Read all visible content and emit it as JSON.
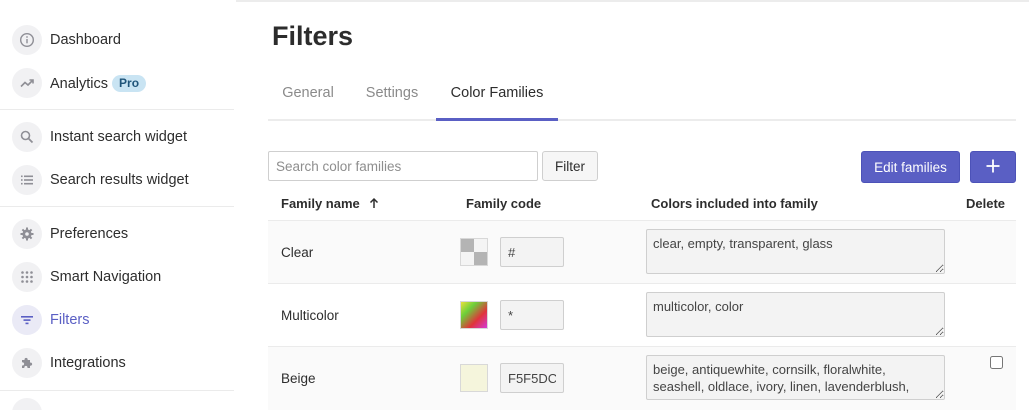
{
  "sidebar": {
    "items": [
      {
        "label": "Dashboard",
        "icon": "info-icon"
      },
      {
        "label": "Analytics",
        "badge": "Pro",
        "icon": "trending-up-icon"
      },
      {
        "label": "Instant search widget",
        "icon": "search-icon"
      },
      {
        "label": "Search results widget",
        "icon": "list-icon"
      },
      {
        "label": "Preferences",
        "icon": "gear-icon"
      },
      {
        "label": "Smart Navigation",
        "icon": "grid-icon"
      },
      {
        "label": "Filters",
        "icon": "filter-icon",
        "active": true
      },
      {
        "label": "Integrations",
        "icon": "puzzle-icon"
      }
    ]
  },
  "page": {
    "title": "Filters"
  },
  "tabs": [
    {
      "label": "General"
    },
    {
      "label": "Settings"
    },
    {
      "label": "Color Families",
      "active": true
    }
  ],
  "toolbar": {
    "search_placeholder": "Search color families",
    "filter_label": "Filter",
    "edit_label": "Edit families",
    "add_icon": "plus-icon"
  },
  "table": {
    "headers": {
      "name": "Family name",
      "name_sort_icon": "arrow-up-icon",
      "code": "Family code",
      "colors": "Colors included into family",
      "delete": "Delete"
    },
    "rows": [
      {
        "name": "Clear",
        "code": "#",
        "colors": "clear, empty, transparent, glass",
        "swatch": "transparent-checker",
        "delete_visible": false
      },
      {
        "name": "Multicolor",
        "code": "*",
        "colors": "multicolor, color",
        "swatch": "multicolor-gradient",
        "delete_visible": false
      },
      {
        "name": "Beige",
        "code": "F5F5DC",
        "colors": "beige, antiquewhite, cornsilk, floralwhite, seashell, oldlace, ivory, linen, lavenderblush,",
        "swatch": "#F5F5DC",
        "delete_visible": true
      }
    ]
  },
  "colors": {
    "accent": "#5a5fc4",
    "badge_bg": "#c9e4f3"
  }
}
